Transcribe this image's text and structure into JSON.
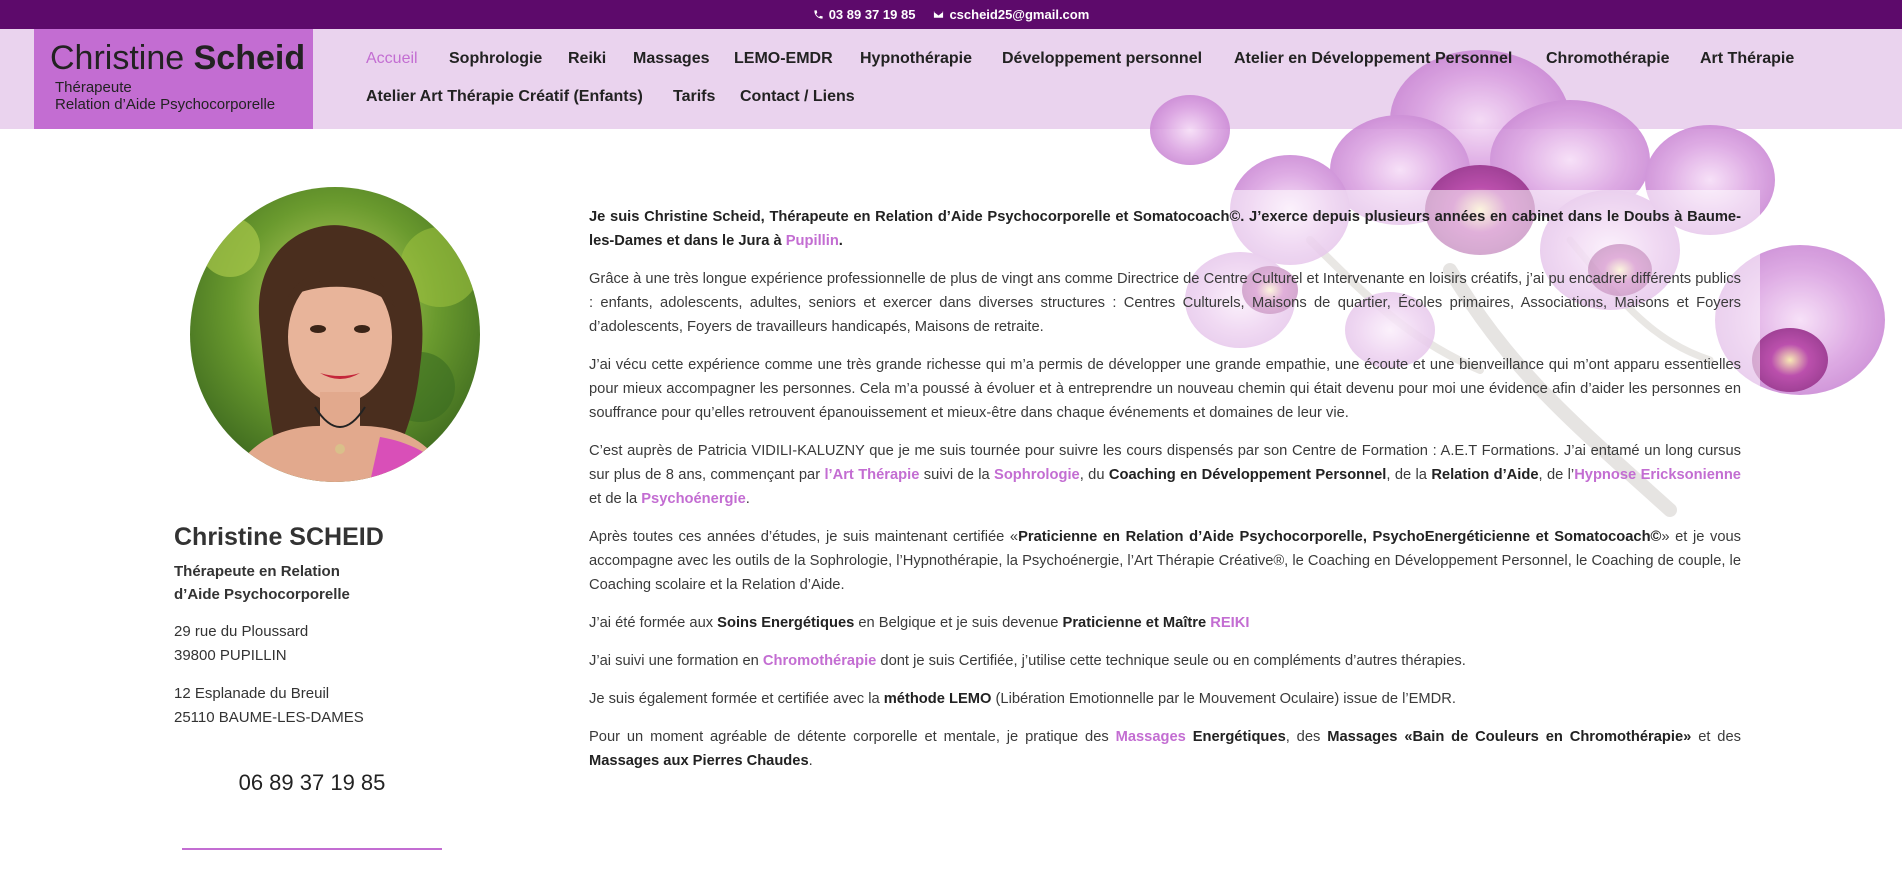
{
  "topbar": {
    "phone": "03 89 37 19 85",
    "email": "cscheid25@gmail.com"
  },
  "logo": {
    "first_name": "Christine",
    "last_name": "Scheid",
    "line1": "Thérapeute",
    "line2": "Relation d’Aide Psychocorporelle"
  },
  "nav": [
    {
      "label": "Accueil",
      "active": true
    },
    {
      "label": "Sophrologie"
    },
    {
      "label": "Reiki"
    },
    {
      "label": "Massages"
    },
    {
      "label": "LEMO-EMDR"
    },
    {
      "label": "Hypnothérapie"
    },
    {
      "label": "Développement personnel"
    },
    {
      "label": "Atelier en Développement Personnel"
    },
    {
      "label": "Chromothérapie"
    },
    {
      "label": "Art Thérapie"
    },
    {
      "label": "Atelier Art Thérapie Créatif (Enfants)"
    },
    {
      "label": "Tarifs"
    },
    {
      "label": "Contact / Liens"
    }
  ],
  "sidebar": {
    "name": "Christine SCHEID",
    "title_line1": "Thérapeute en Relation",
    "title_line2": "d’Aide Psychocorporelle",
    "address1_line1": "29 rue du Ploussard",
    "address1_line2": "39800 PUPILLIN",
    "address2_line1": "12 Esplanade du Breuil",
    "address2_line2": "25110 BAUME-LES-DAMES",
    "phone": "06 89 37 19 85"
  },
  "colors": {
    "topbar": "#5d0a6b",
    "header": "#ead3ee",
    "accent": "#c36dd2"
  },
  "content": {
    "p1": [
      {
        "t": "Je suis Christine Scheid, Thérapeute en Relation d’Aide Psychocorporelle et Somatocoach©. J’exerce depuis plusieurs années en cabinet dans le Doubs à Baume-les-Dames et dans le Jura à ",
        "s": "b"
      },
      {
        "t": "Pupillin",
        "s": "link"
      },
      {
        "t": ".",
        "s": "b"
      }
    ],
    "p2": [
      {
        "t": "Grâce à une très longue expérience professionnelle de plus de vingt ans comme Directrice de Centre Culturel et Intervenante en loisirs créatifs, j’ai pu encadrer différents publics : enfants, adolescents, adultes, seniors et exercer dans diverses structures : Centres Culturels, Maisons de quartier, Écoles primaires, Associations, Maisons et Foyers d’adolescents, Foyers de travailleurs handicapés, Maisons de retraite."
      }
    ],
    "p3": [
      {
        "t": "J’ai vécu cette expérience comme une très grande richesse qui m’a permis de développer une grande empathie, une écoute et une bienveillance qui m’ont apparu essentielles pour mieux accompagner les personnes. Cela m’a poussé à évoluer et à entreprendre un nouveau chemin qui était devenu pour moi une évidence afin d’aider les personnes en souffrance pour qu’elles retrouvent épanouissement et mieux-être dans chaque événements et domaines de leur vie."
      }
    ],
    "p4": [
      {
        "t": "C’est auprès de Patricia VIDILI-KALUZNY que je me suis tournée pour suivre les cours dispensés par son Centre de Formation : A.E.T Formations. J’ai entamé un long cursus sur plus de 8 ans, commençant par "
      },
      {
        "t": "l’Art Thérapie",
        "s": "link"
      },
      {
        "t": " suivi de la "
      },
      {
        "t": "Sophrologie",
        "s": "link"
      },
      {
        "t": ", du "
      },
      {
        "t": "Coaching en Développement Personnel",
        "s": "b"
      },
      {
        "t": ", de la "
      },
      {
        "t": "Relation d’Aide",
        "s": "b"
      },
      {
        "t": ", de l’"
      },
      {
        "t": "Hypnose Ericksonienne",
        "s": "link"
      },
      {
        "t": " et de la "
      },
      {
        "t": "Psychoénergie",
        "s": "link"
      },
      {
        "t": "."
      }
    ],
    "p5": [
      {
        "t": "Après toutes ces années d’études, je suis maintenant certifiée «"
      },
      {
        "t": "Praticienne en Relation d’Aide Psychocorporelle, PsychoEnergéticienne et Somatocoach©",
        "s": "b"
      },
      {
        "t": "» et je vous accompagne avec les outils de la Sophrologie, l’Hypnothérapie, la Psychoénergie, l’Art Thérapie Créative®, le Coaching en Développement Personnel, le Coaching de couple, le Coaching scolaire et la Relation d’Aide."
      }
    ],
    "p6": [
      {
        "t": "J’ai été formée aux "
      },
      {
        "t": "Soins Energétiques",
        "s": "b"
      },
      {
        "t": " en Belgique et je suis devenue "
      },
      {
        "t": "Praticienne et Maître ",
        "s": "b"
      },
      {
        "t": "REIKI",
        "s": "link"
      }
    ],
    "p7": [
      {
        "t": "J’ai suivi une formation en "
      },
      {
        "t": "Chromothérapie",
        "s": "link"
      },
      {
        "t": " dont je suis Certifiée, j’utilise cette technique seule ou en compléments d’autres thérapies."
      }
    ],
    "p8": [
      {
        "t": "Je suis également formée et certifiée avec la "
      },
      {
        "t": "méthode LEMO",
        "s": "b"
      },
      {
        "t": " (Libération Emotionnelle par le Mouvement Oculaire) issue de l’EMDR."
      }
    ],
    "p9": [
      {
        "t": "Pour un moment agréable de détente corporelle et mentale, je pratique des "
      },
      {
        "t": "Massages",
        "s": "link"
      },
      {
        "t": " "
      },
      {
        "t": "Energétiques",
        "s": "b"
      },
      {
        "t": ", des "
      },
      {
        "t": "Massages «Bain de Couleurs en Chromothérapie»",
        "s": "b"
      },
      {
        "t": " et des "
      },
      {
        "t": "Massages aux Pierres Chaudes",
        "s": "b"
      },
      {
        "t": "."
      }
    ]
  }
}
